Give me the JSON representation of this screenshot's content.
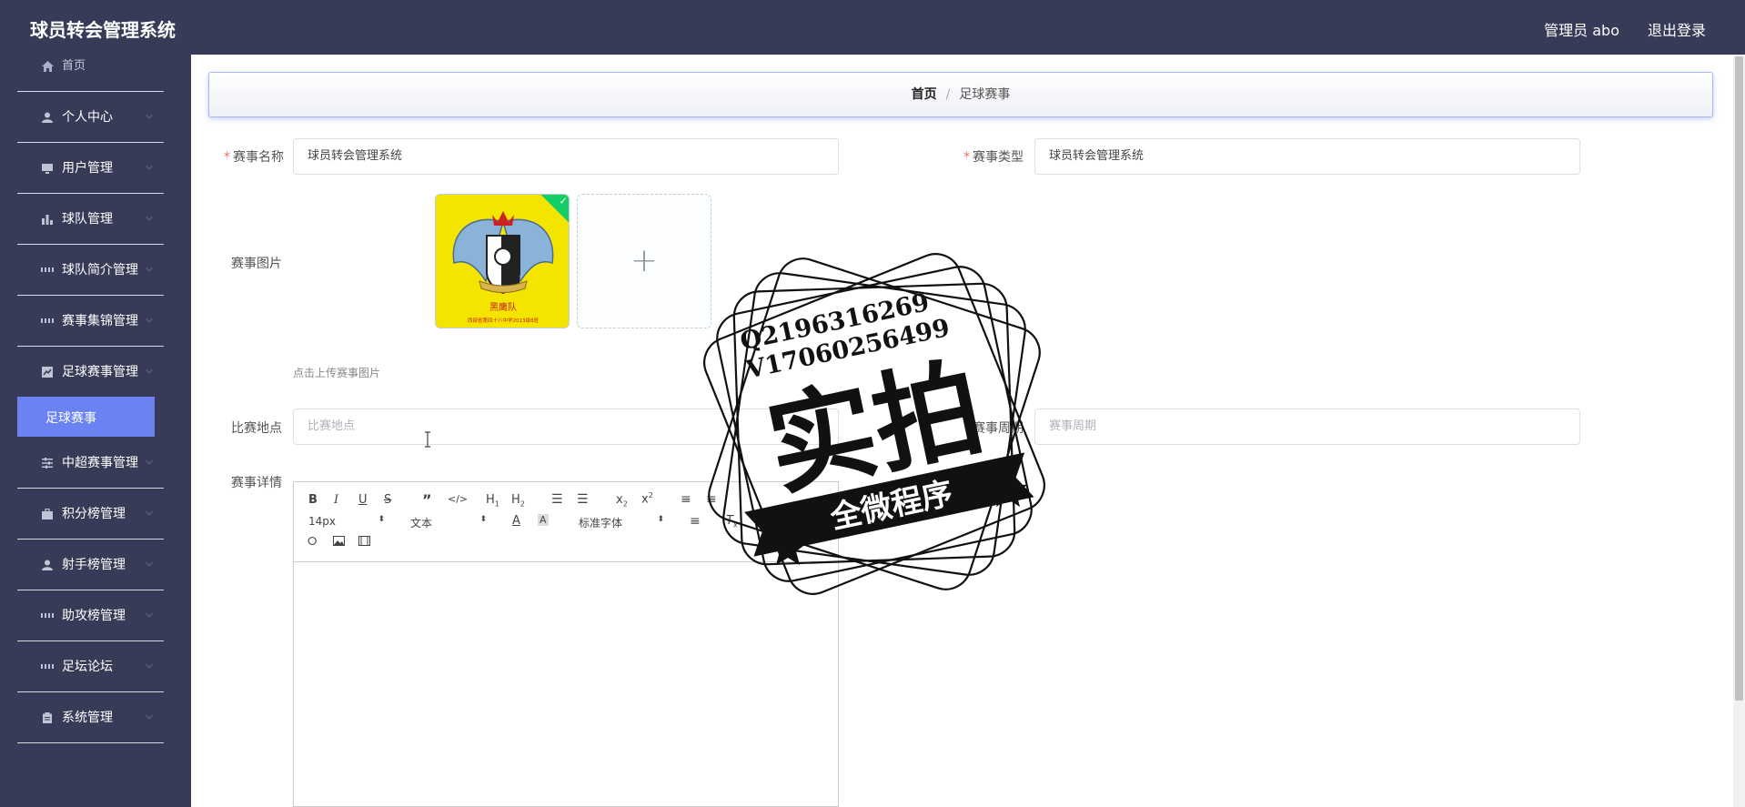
{
  "header": {
    "app_title": "球员转会管理系统",
    "admin_label": "管理员 abo",
    "logout_label": "退出登录"
  },
  "sidebar": {
    "home": "首页",
    "items": [
      {
        "label": "个人中心",
        "icon": "user-icon"
      },
      {
        "label": "用户管理",
        "icon": "monitor-icon"
      },
      {
        "label": "球队管理",
        "icon": "bar-chart-icon"
      },
      {
        "label": "球队简介管理",
        "icon": "grid-icon"
      },
      {
        "label": "赛事集锦管理",
        "icon": "grid-icon"
      },
      {
        "label": "足球赛事管理",
        "icon": "chart-box-icon"
      },
      {
        "label": "中超赛事管理",
        "icon": "sliders-icon"
      },
      {
        "label": "积分榜管理",
        "icon": "briefcase-icon"
      },
      {
        "label": "射手榜管理",
        "icon": "user-icon"
      },
      {
        "label": "助攻榜管理",
        "icon": "grid-icon"
      },
      {
        "label": "足坛论坛",
        "icon": "grid-icon"
      },
      {
        "label": "系统管理",
        "icon": "clipboard-icon"
      }
    ],
    "active_submenu": "足球赛事"
  },
  "breadcrumb": {
    "home": "首页",
    "separator": "/",
    "current": "足球赛事"
  },
  "form": {
    "event_name_label": "赛事名称",
    "event_name_value": "球员转会管理系统",
    "event_type_label": "赛事类型",
    "event_type_value": "球员转会管理系统",
    "event_image_label": "赛事图片",
    "upload_tip": "点击上传赛事图片",
    "venue_label": "比赛地点",
    "venue_placeholder": "比赛地点",
    "cycle_label": "赛事周期",
    "cycle_placeholder": "赛事周期",
    "detail_label": "赛事详情"
  },
  "uploaded_image": {
    "caption_top": "黑鹰队",
    "caption_bottom": "西部省第四十八中学2013级8班"
  },
  "editor": {
    "font_size": "14px",
    "paragraph": "文本",
    "font_family": "标准字体"
  },
  "watermark": {
    "line1": "Q2196316269",
    "line2": "V17060256499",
    "big_text": "实拍",
    "ribbon_text": "全微程序"
  },
  "colors": {
    "header_bg": "#373b57",
    "active_menu": "#6b82f3",
    "required": "#f56c6c"
  }
}
